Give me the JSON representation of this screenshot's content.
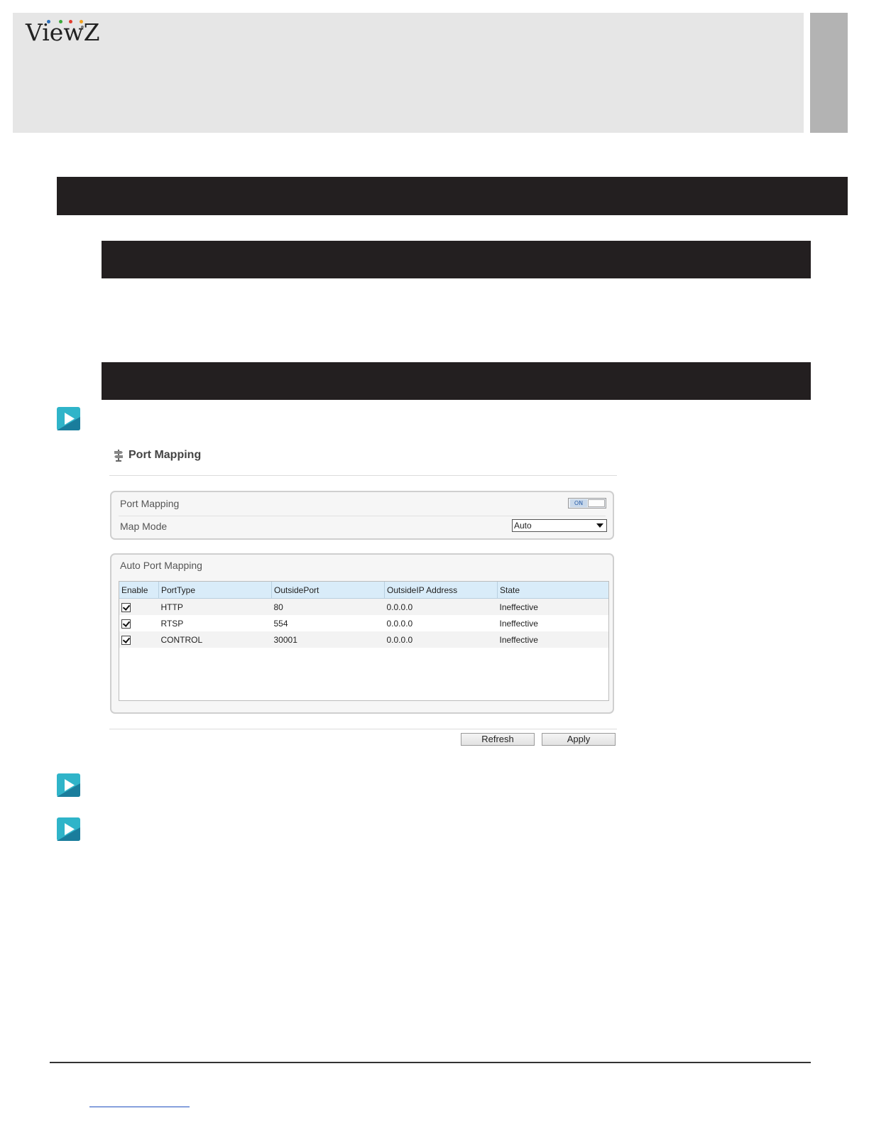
{
  "brand": {
    "logo_text_1": "Vie",
    "logo_text_2": "w",
    "logo_text_3": "Z",
    "dot_colors": [
      "#2a6ebb",
      "#3aa83a",
      "#e23b2e",
      "#f0a020",
      "#7a7a7a"
    ]
  },
  "section_bars": [
    "",
    "",
    ""
  ],
  "ui_panel": {
    "title": "Port Mapping",
    "port_mapping_label": "Port Mapping",
    "toggle_state": "ON",
    "map_mode_label": "Map Mode",
    "map_mode_value": "Auto",
    "auto_section_title": "Auto Port Mapping",
    "columns": [
      "Enable",
      "PortType",
      "OutsidePort",
      "OutsideIP Address",
      "State"
    ],
    "rows": [
      {
        "enabled": true,
        "port_type": "HTTP",
        "outside_port": "80",
        "outside_ip": "0.0.0.0",
        "state": "Ineffective"
      },
      {
        "enabled": true,
        "port_type": "RTSP",
        "outside_port": "554",
        "outside_ip": "0.0.0.0",
        "state": "Ineffective"
      },
      {
        "enabled": true,
        "port_type": "CONTROL",
        "outside_port": "30001",
        "outside_ip": "0.0.0.0",
        "state": "Ineffective"
      }
    ],
    "refresh_label": "Refresh",
    "apply_label": "Apply"
  },
  "colors": {
    "bar": "#231f20",
    "header": "#e6e6e6",
    "tab": "#b3b3b3",
    "play_icon_light": "#2fb4c9",
    "play_icon_dark": "#1a7d9c"
  }
}
